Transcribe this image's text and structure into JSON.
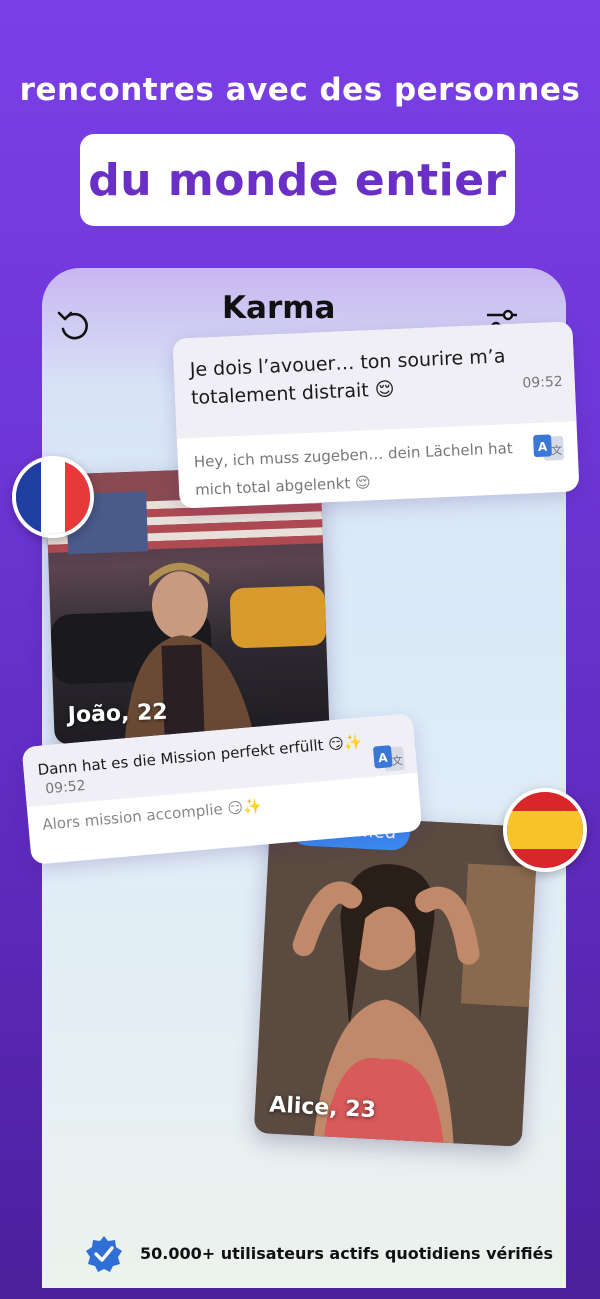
{
  "header": {
    "line1": "rencontres avec des personnes",
    "line2": "du monde entier"
  },
  "app": {
    "title": "Karma",
    "icons": {
      "left": "undo-icon",
      "right": "filter-icon"
    }
  },
  "message1": {
    "text": "Je dois l’avouer… ton sourire m’a totalement distrait 😌",
    "time": "09:52",
    "translation": "Hey, ich muss zugeben… dein Lächeln hat mich total abgelenkt 😌"
  },
  "profile1": {
    "name": "João, 22",
    "flag": "france"
  },
  "message2": {
    "text": "Dann hat es die Mission perfekt erfüllt 😏✨",
    "time": "09:52",
    "translation": "Alors mission accomplie 😏✨"
  },
  "profile2": {
    "name": "Alice, 23",
    "badge": "Verified",
    "flag": "spain"
  },
  "footer": {
    "text": "50.000+ utilisateurs actifs quotidiens vérifiés"
  },
  "colors": {
    "accent": "#6a2fc6",
    "verified": "#3a8ef6",
    "france_blue": "#1f3fa0",
    "france_red": "#e63a3a",
    "spain_red": "#d8262b",
    "spain_yellow": "#f6c42a"
  }
}
